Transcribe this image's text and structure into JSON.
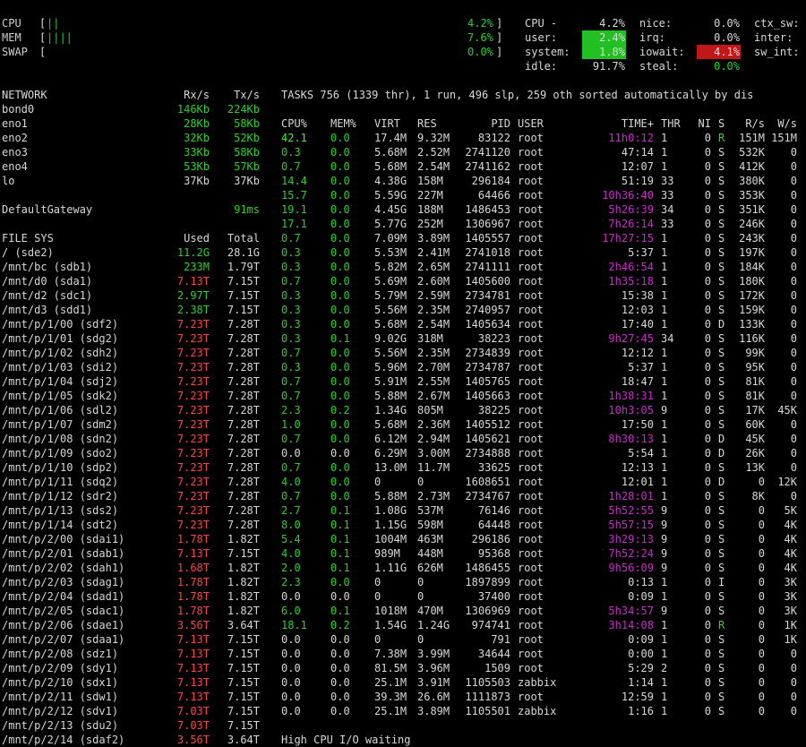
{
  "colors": {
    "green": "#2bd12b",
    "red": "#ff4545",
    "magenta": "#c82cc8",
    "text": "#d8d8d8",
    "hl_green": "#22c022",
    "hl_red": "#c01818",
    "bg": "#000000"
  },
  "top": {
    "cpu": {
      "label": "CPU",
      "bar": "||",
      "pct": "4.2%"
    },
    "mem": {
      "label": "MEM",
      "bar": "||||",
      "pct": "7.6%"
    },
    "swap": {
      "label": "SWAP",
      "bar": "",
      "pct": "0.0%"
    }
  },
  "cpu_detail": [
    [
      {
        "l": "CPU -",
        "v": "4.2%"
      },
      {
        "l": "nice:",
        "v": "0.0%"
      },
      {
        "l": "ctx_sw:",
        "v": ""
      }
    ],
    [
      {
        "l": "user:",
        "v": "2.4%",
        "hl": "green"
      },
      {
        "l": "irq:",
        "v": "0.0%"
      },
      {
        "l": "inter:",
        "v": ""
      }
    ],
    [
      {
        "l": "system:",
        "v": "1.8%",
        "hl": "green"
      },
      {
        "l": "iowait:",
        "v": "4.1%",
        "hl": "red"
      },
      {
        "l": "sw_int:",
        "v": ""
      }
    ],
    [
      {
        "l": "idle:",
        "v": "91.7%"
      },
      {
        "l": "steal:",
        "v": "0.0%"
      },
      {
        "l": "",
        "v": ""
      }
    ]
  ],
  "network": {
    "header": {
      "name": "NETWORK",
      "rx": "Rx/s",
      "tx": "Tx/s"
    },
    "rows": [
      {
        "name": "bond0",
        "rx": "146Kb",
        "tx": "224Kb",
        "rxc": "g",
        "txc": "g"
      },
      {
        "name": "eno1",
        "rx": "28Kb",
        "tx": "58Kb",
        "rxc": "g",
        "txc": "g"
      },
      {
        "name": "eno2",
        "rx": "32Kb",
        "tx": "52Kb",
        "rxc": "g",
        "txc": "g"
      },
      {
        "name": "eno3",
        "rx": "33Kb",
        "tx": "58Kb",
        "rxc": "g",
        "txc": "g"
      },
      {
        "name": "eno4",
        "rx": "53Kb",
        "tx": "57Kb",
        "rxc": "g",
        "txc": "g"
      },
      {
        "name": "lo",
        "rx": "37Kb",
        "tx": "37Kb",
        "rxc": "w",
        "txc": "w"
      }
    ],
    "gateway": {
      "label": "DefaultGateway",
      "value": "91ms"
    }
  },
  "filesys": {
    "header": {
      "name": "FILE SYS",
      "used": "Used",
      "total": "Total"
    },
    "rows": [
      {
        "name": "/ (sde2)",
        "used": "11.2G",
        "total": "28.1G",
        "c": "g"
      },
      {
        "name": "/mnt/bc (sdb1)",
        "used": "233M",
        "total": "1.79T",
        "c": "g"
      },
      {
        "name": "/mnt/d0 (sda1)",
        "used": "7.13T",
        "total": "7.15T",
        "c": "r"
      },
      {
        "name": "/mnt/d2 (sdc1)",
        "used": "2.97T",
        "total": "7.15T",
        "c": "g"
      },
      {
        "name": "/mnt/d3 (sdd1)",
        "used": "2.38T",
        "total": "7.15T",
        "c": "g"
      },
      {
        "name": "/mnt/p/1/00 (sdf2)",
        "used": "7.23T",
        "total": "7.28T",
        "c": "r"
      },
      {
        "name": "/mnt/p/1/01 (sdg2)",
        "used": "7.23T",
        "total": "7.28T",
        "c": "r"
      },
      {
        "name": "/mnt/p/1/02 (sdh2)",
        "used": "7.23T",
        "total": "7.28T",
        "c": "r"
      },
      {
        "name": "/mnt/p/1/03 (sdi2)",
        "used": "7.23T",
        "total": "7.28T",
        "c": "r"
      },
      {
        "name": "/mnt/p/1/04 (sdj2)",
        "used": "7.23T",
        "total": "7.28T",
        "c": "r"
      },
      {
        "name": "/mnt/p/1/05 (sdk2)",
        "used": "7.23T",
        "total": "7.28T",
        "c": "r"
      },
      {
        "name": "/mnt/p/1/06 (sdl2)",
        "used": "7.23T",
        "total": "7.28T",
        "c": "r"
      },
      {
        "name": "/mnt/p/1/07 (sdm2)",
        "used": "7.23T",
        "total": "7.28T",
        "c": "r"
      },
      {
        "name": "/mnt/p/1/08 (sdn2)",
        "used": "7.23T",
        "total": "7.28T",
        "c": "r"
      },
      {
        "name": "/mnt/p/1/09 (sdo2)",
        "used": "7.23T",
        "total": "7.28T",
        "c": "r"
      },
      {
        "name": "/mnt/p/1/10 (sdp2)",
        "used": "7.23T",
        "total": "7.28T",
        "c": "r"
      },
      {
        "name": "/mnt/p/1/11 (sdq2)",
        "used": "7.23T",
        "total": "7.28T",
        "c": "r"
      },
      {
        "name": "/mnt/p/1/12 (sdr2)",
        "used": "7.23T",
        "total": "7.28T",
        "c": "r"
      },
      {
        "name": "/mnt/p/1/13 (sds2)",
        "used": "7.23T",
        "total": "7.28T",
        "c": "r"
      },
      {
        "name": "/mnt/p/1/14 (sdt2)",
        "used": "7.23T",
        "total": "7.28T",
        "c": "r"
      },
      {
        "name": "/mnt/p/2/00 (sdai1)",
        "used": "1.78T",
        "total": "1.82T",
        "c": "r"
      },
      {
        "name": "/mnt/p/2/01 (sdab1)",
        "used": "7.13T",
        "total": "7.15T",
        "c": "r"
      },
      {
        "name": "/mnt/p/2/02 (sdah1)",
        "used": "1.68T",
        "total": "1.82T",
        "c": "r"
      },
      {
        "name": "/mnt/p/2/03 (sdag1)",
        "used": "1.78T",
        "total": "1.82T",
        "c": "r"
      },
      {
        "name": "/mnt/p/2/04 (sdad1)",
        "used": "1.78T",
        "total": "1.82T",
        "c": "r"
      },
      {
        "name": "/mnt/p/2/05 (sdac1)",
        "used": "1.78T",
        "total": "1.82T",
        "c": "r"
      },
      {
        "name": "/mnt/p/2/06 (sdae1)",
        "used": "3.56T",
        "total": "3.64T",
        "c": "r"
      },
      {
        "name": "/mnt/p/2/07 (sdaa1)",
        "used": "7.13T",
        "total": "7.15T",
        "c": "r"
      },
      {
        "name": "/mnt/p/2/08 (sdz1)",
        "used": "7.13T",
        "total": "7.15T",
        "c": "r"
      },
      {
        "name": "/mnt/p/2/09 (sdy1)",
        "used": "7.13T",
        "total": "7.15T",
        "c": "r"
      },
      {
        "name": "/mnt/p/2/10 (sdx1)",
        "used": "7.13T",
        "total": "7.15T",
        "c": "r"
      },
      {
        "name": "/mnt/p/2/11 (sdw1)",
        "used": "7.13T",
        "total": "7.15T",
        "c": "r"
      },
      {
        "name": "/mnt/p/2/12 (sdv1)",
        "used": "7.03T",
        "total": "7.15T",
        "c": "r"
      },
      {
        "name": "/mnt/p/2/13 (sdu2)",
        "used": "7.03T",
        "total": "7.15T",
        "c": "r"
      },
      {
        "name": "/mnt/p/2/14 (sdaf2)",
        "used": "3.56T",
        "total": "3.64T",
        "c": "r"
      }
    ]
  },
  "tasks_summary": "TASKS 756 (1339 thr), 1 run, 496 slp, 259 oth sorted automatically by dis",
  "process_header": {
    "cpu": "CPU%",
    "mem": "MEM%",
    "virt": "VIRT",
    "res": "RES",
    "pid": "PID",
    "user": "USER",
    "time": "TIME+",
    "thr": "THR",
    "ni": "NI",
    "s": "S",
    "rs": "R/s",
    "ws": "W/s"
  },
  "processes": [
    {
      "cpu": "42.1",
      "mem": "0.0",
      "virt": "17.4M",
      "res": "9.32M",
      "pid": "83122",
      "user": "root",
      "time": "11h0:12",
      "thr": "1",
      "ni": "0",
      "s": "R",
      "rs": "151M",
      "ws": "151M",
      "tc": "m",
      "cc": "wg",
      "sc": "g"
    },
    {
      "cpu": "0.3",
      "mem": "0.0",
      "virt": "5.68M",
      "res": "2.52M",
      "pid": "2741120",
      "user": "root",
      "time": "47:14",
      "thr": "1",
      "ni": "0",
      "s": "S",
      "rs": "532K",
      "ws": "0",
      "tc": "w",
      "cc": "g",
      "sc": "w"
    },
    {
      "cpu": "0.7",
      "mem": "0.0",
      "virt": "5.68M",
      "res": "2.54M",
      "pid": "2741162",
      "user": "root",
      "time": "12:07",
      "thr": "1",
      "ni": "0",
      "s": "S",
      "rs": "412K",
      "ws": "0",
      "tc": "w",
      "cc": "g",
      "sc": "w"
    },
    {
      "cpu": "14.4",
      "mem": "0.0",
      "virt": "4.38G",
      "res": "158M",
      "pid": "296184",
      "user": "root",
      "time": "51:19",
      "thr": "33",
      "ni": "0",
      "s": "S",
      "rs": "380K",
      "ws": "0",
      "tc": "w",
      "cc": "g",
      "sc": "w"
    },
    {
      "cpu": "15.7",
      "mem": "0.0",
      "virt": "5.59G",
      "res": "227M",
      "pid": "64466",
      "user": "root",
      "time": "10h36:40",
      "thr": "33",
      "ni": "0",
      "s": "S",
      "rs": "353K",
      "ws": "0",
      "tc": "m",
      "cc": "g",
      "sc": "w"
    },
    {
      "cpu": "19.1",
      "mem": "0.0",
      "virt": "4.45G",
      "res": "188M",
      "pid": "1486453",
      "user": "root",
      "time": "5h26:39",
      "thr": "34",
      "ni": "0",
      "s": "S",
      "rs": "351K",
      "ws": "0",
      "tc": "m",
      "cc": "g",
      "sc": "w"
    },
    {
      "cpu": "17.1",
      "mem": "0.0",
      "virt": "5.77G",
      "res": "252M",
      "pid": "1306967",
      "user": "root",
      "time": "7h26:14",
      "thr": "33",
      "ni": "0",
      "s": "S",
      "rs": "246K",
      "ws": "0",
      "tc": "m",
      "cc": "g",
      "sc": "w"
    },
    {
      "cpu": "0.7",
      "mem": "0.0",
      "virt": "7.09M",
      "res": "3.89M",
      "pid": "1405557",
      "user": "root",
      "time": "17h27:15",
      "thr": "1",
      "ni": "0",
      "s": "S",
      "rs": "243K",
      "ws": "0",
      "tc": "m",
      "cc": "g",
      "sc": "w"
    },
    {
      "cpu": "0.3",
      "mem": "0.0",
      "virt": "5.53M",
      "res": "2.41M",
      "pid": "2741018",
      "user": "root",
      "time": "5:37",
      "thr": "1",
      "ni": "0",
      "s": "S",
      "rs": "197K",
      "ws": "0",
      "tc": "w",
      "cc": "g",
      "sc": "w"
    },
    {
      "cpu": "0.3",
      "mem": "0.0",
      "virt": "5.82M",
      "res": "2.65M",
      "pid": "2741111",
      "user": "root",
      "time": "2h46:54",
      "thr": "1",
      "ni": "0",
      "s": "S",
      "rs": "184K",
      "ws": "0",
      "tc": "m",
      "cc": "g",
      "sc": "w"
    },
    {
      "cpu": "0.7",
      "mem": "0.0",
      "virt": "5.69M",
      "res": "2.60M",
      "pid": "1405600",
      "user": "root",
      "time": "1h35:18",
      "thr": "1",
      "ni": "0",
      "s": "S",
      "rs": "180K",
      "ws": "0",
      "tc": "m",
      "cc": "g",
      "sc": "w"
    },
    {
      "cpu": "0.3",
      "mem": "0.0",
      "virt": "5.79M",
      "res": "2.59M",
      "pid": "2734781",
      "user": "root",
      "time": "15:38",
      "thr": "1",
      "ni": "0",
      "s": "S",
      "rs": "172K",
      "ws": "0",
      "tc": "w",
      "cc": "g",
      "sc": "w"
    },
    {
      "cpu": "0.3",
      "mem": "0.0",
      "virt": "5.56M",
      "res": "2.35M",
      "pid": "2740957",
      "user": "root",
      "time": "12:03",
      "thr": "1",
      "ni": "0",
      "s": "S",
      "rs": "159K",
      "ws": "0",
      "tc": "w",
      "cc": "g",
      "sc": "w"
    },
    {
      "cpu": "0.3",
      "mem": "0.0",
      "virt": "5.68M",
      "res": "2.54M",
      "pid": "1405634",
      "user": "root",
      "time": "17:40",
      "thr": "1",
      "ni": "0",
      "s": "D",
      "rs": "133K",
      "ws": "0",
      "tc": "w",
      "cc": "g",
      "sc": "w"
    },
    {
      "cpu": "0.3",
      "mem": "0.1",
      "virt": "9.02G",
      "res": "318M",
      "pid": "38223",
      "user": "root",
      "time": "9h27:45",
      "thr": "34",
      "ni": "0",
      "s": "S",
      "rs": "116K",
      "ws": "0",
      "tc": "m",
      "cc": "g",
      "sc": "w"
    },
    {
      "cpu": "0.7",
      "mem": "0.0",
      "virt": "5.56M",
      "res": "2.35M",
      "pid": "2734839",
      "user": "root",
      "time": "12:12",
      "thr": "1",
      "ni": "0",
      "s": "S",
      "rs": "99K",
      "ws": "0",
      "tc": "w",
      "cc": "g",
      "sc": "w"
    },
    {
      "cpu": "0.3",
      "mem": "0.0",
      "virt": "5.96M",
      "res": "2.70M",
      "pid": "2734787",
      "user": "root",
      "time": "5:37",
      "thr": "1",
      "ni": "0",
      "s": "S",
      "rs": "95K",
      "ws": "0",
      "tc": "w",
      "cc": "g",
      "sc": "w"
    },
    {
      "cpu": "0.7",
      "mem": "0.0",
      "virt": "5.91M",
      "res": "2.55M",
      "pid": "1405765",
      "user": "root",
      "time": "18:47",
      "thr": "1",
      "ni": "0",
      "s": "S",
      "rs": "81K",
      "ws": "0",
      "tc": "w",
      "cc": "g",
      "sc": "w"
    },
    {
      "cpu": "0.7",
      "mem": "0.0",
      "virt": "5.88M",
      "res": "2.67M",
      "pid": "1405663",
      "user": "root",
      "time": "1h38:31",
      "thr": "1",
      "ni": "0",
      "s": "S",
      "rs": "81K",
      "ws": "0",
      "tc": "m",
      "cc": "g",
      "sc": "w"
    },
    {
      "cpu": "2.3",
      "mem": "0.2",
      "virt": "1.34G",
      "res": "805M",
      "pid": "38225",
      "user": "root",
      "time": "10h3:05",
      "thr": "9",
      "ni": "0",
      "s": "S",
      "rs": "17K",
      "ws": "45K",
      "tc": "m",
      "cc": "g",
      "sc": "w"
    },
    {
      "cpu": "1.0",
      "mem": "0.0",
      "virt": "5.68M",
      "res": "2.36M",
      "pid": "1405512",
      "user": "root",
      "time": "17:50",
      "thr": "1",
      "ni": "0",
      "s": "S",
      "rs": "60K",
      "ws": "0",
      "tc": "w",
      "cc": "g",
      "sc": "w"
    },
    {
      "cpu": "0.7",
      "mem": "0.0",
      "virt": "6.12M",
      "res": "2.94M",
      "pid": "1405621",
      "user": "root",
      "time": "8h30:13",
      "thr": "1",
      "ni": "0",
      "s": "D",
      "rs": "45K",
      "ws": "0",
      "tc": "m",
      "cc": "g",
      "sc": "w"
    },
    {
      "cpu": "0.0",
      "mem": "0.0",
      "virt": "6.29M",
      "res": "3.00M",
      "pid": "2734888",
      "user": "root",
      "time": "5:54",
      "thr": "1",
      "ni": "0",
      "s": "D",
      "rs": "26K",
      "ws": "0",
      "tc": "w",
      "cc": "w",
      "sc": "w"
    },
    {
      "cpu": "0.7",
      "mem": "0.0",
      "virt": "13.0M",
      "res": "11.7M",
      "pid": "33625",
      "user": "root",
      "time": "12:13",
      "thr": "1",
      "ni": "0",
      "s": "S",
      "rs": "13K",
      "ws": "0",
      "tc": "w",
      "cc": "g",
      "sc": "w"
    },
    {
      "cpu": "4.0",
      "mem": "0.0",
      "virt": "0",
      "res": "0",
      "pid": "1608651",
      "user": "root",
      "time": "12:01",
      "thr": "1",
      "ni": "0",
      "s": "D",
      "rs": "0",
      "ws": "12K",
      "tc": "w",
      "cc": "g",
      "sc": "w"
    },
    {
      "cpu": "0.7",
      "mem": "0.0",
      "virt": "5.88M",
      "res": "2.73M",
      "pid": "2734767",
      "user": "root",
      "time": "1h28:01",
      "thr": "1",
      "ni": "0",
      "s": "S",
      "rs": "8K",
      "ws": "0",
      "tc": "m",
      "cc": "g",
      "sc": "w"
    },
    {
      "cpu": "2.7",
      "mem": "0.1",
      "virt": "1.08G",
      "res": "537M",
      "pid": "76146",
      "user": "root",
      "time": "5h52:55",
      "thr": "9",
      "ni": "0",
      "s": "S",
      "rs": "0",
      "ws": "5K",
      "tc": "m",
      "cc": "g",
      "sc": "w"
    },
    {
      "cpu": "8.0",
      "mem": "0.1",
      "virt": "1.15G",
      "res": "598M",
      "pid": "64448",
      "user": "root",
      "time": "5h57:15",
      "thr": "9",
      "ni": "0",
      "s": "S",
      "rs": "0",
      "ws": "4K",
      "tc": "m",
      "cc": "g",
      "sc": "w"
    },
    {
      "cpu": "5.4",
      "mem": "0.1",
      "virt": "1004M",
      "res": "463M",
      "pid": "296186",
      "user": "root",
      "time": "3h29:13",
      "thr": "9",
      "ni": "0",
      "s": "S",
      "rs": "0",
      "ws": "4K",
      "tc": "m",
      "cc": "g",
      "sc": "w"
    },
    {
      "cpu": "4.0",
      "mem": "0.1",
      "virt": "989M",
      "res": "448M",
      "pid": "95368",
      "user": "root",
      "time": "7h52:24",
      "thr": "9",
      "ni": "0",
      "s": "S",
      "rs": "0",
      "ws": "4K",
      "tc": "m",
      "cc": "g",
      "sc": "w"
    },
    {
      "cpu": "2.0",
      "mem": "0.1",
      "virt": "1.11G",
      "res": "626M",
      "pid": "1486455",
      "user": "root",
      "time": "9h56:09",
      "thr": "9",
      "ni": "0",
      "s": "S",
      "rs": "0",
      "ws": "4K",
      "tc": "m",
      "cc": "g",
      "sc": "w"
    },
    {
      "cpu": "2.3",
      "mem": "0.0",
      "virt": "0",
      "res": "0",
      "pid": "1897899",
      "user": "root",
      "time": "0:13",
      "thr": "1",
      "ni": "0",
      "s": "I",
      "rs": "0",
      "ws": "3K",
      "tc": "w",
      "cc": "g",
      "sc": "w"
    },
    {
      "cpu": "0.0",
      "mem": "0.0",
      "virt": "0",
      "res": "0",
      "pid": "37400",
      "user": "root",
      "time": "0:09",
      "thr": "1",
      "ni": "0",
      "s": "S",
      "rs": "0",
      "ws": "3K",
      "tc": "w",
      "cc": "w",
      "sc": "w"
    },
    {
      "cpu": "6.0",
      "mem": "0.1",
      "virt": "1018M",
      "res": "470M",
      "pid": "1306969",
      "user": "root",
      "time": "5h34:57",
      "thr": "9",
      "ni": "0",
      "s": "S",
      "rs": "0",
      "ws": "3K",
      "tc": "m",
      "cc": "g",
      "sc": "w"
    },
    {
      "cpu": "18.1",
      "mem": "0.2",
      "virt": "1.54G",
      "res": "1.24G",
      "pid": "974741",
      "user": "root",
      "time": "3h14:08",
      "thr": "1",
      "ni": "0",
      "s": "R",
      "rs": "0",
      "ws": "1K",
      "tc": "m",
      "cc": "g",
      "sc": "g"
    },
    {
      "cpu": "0.0",
      "mem": "0.0",
      "virt": "0",
      "res": "0",
      "pid": "791",
      "user": "root",
      "time": "0:09",
      "thr": "1",
      "ni": "0",
      "s": "S",
      "rs": "0",
      "ws": "1K",
      "tc": "w",
      "cc": "w",
      "sc": "w"
    },
    {
      "cpu": "0.0",
      "mem": "0.0",
      "virt": "7.38M",
      "res": "3.99M",
      "pid": "34644",
      "user": "root",
      "time": "0:00",
      "thr": "1",
      "ni": "0",
      "s": "S",
      "rs": "0",
      "ws": "0",
      "tc": "w",
      "cc": "w",
      "sc": "w"
    },
    {
      "cpu": "0.0",
      "mem": "0.0",
      "virt": "81.5M",
      "res": "3.96M",
      "pid": "1509",
      "user": "root",
      "time": "5:29",
      "thr": "2",
      "ni": "0",
      "s": "S",
      "rs": "0",
      "ws": "0",
      "tc": "w",
      "cc": "w",
      "sc": "w"
    },
    {
      "cpu": "0.0",
      "mem": "0.0",
      "virt": "25.1M",
      "res": "3.91M",
      "pid": "1105503",
      "user": "zabbix",
      "time": "1:14",
      "thr": "1",
      "ni": "0",
      "s": "S",
      "rs": "0",
      "ws": "0",
      "tc": "w",
      "cc": "w",
      "sc": "w"
    },
    {
      "cpu": "0.0",
      "mem": "0.0",
      "virt": "39.3M",
      "res": "26.6M",
      "pid": "1111873",
      "user": "root",
      "time": "12:59",
      "thr": "1",
      "ni": "0",
      "s": "S",
      "rs": "0",
      "ws": "0",
      "tc": "w",
      "cc": "w",
      "sc": "w"
    },
    {
      "cpu": "0.0",
      "mem": "0.0",
      "virt": "25.1M",
      "res": "3.89M",
      "pid": "1105501",
      "user": "zabbix",
      "time": "1:16",
      "thr": "1",
      "ni": "0",
      "s": "S",
      "rs": "0",
      "ws": "0",
      "tc": "w",
      "cc": "w",
      "sc": "w"
    }
  ],
  "alert": "High CPU I/O waiting"
}
